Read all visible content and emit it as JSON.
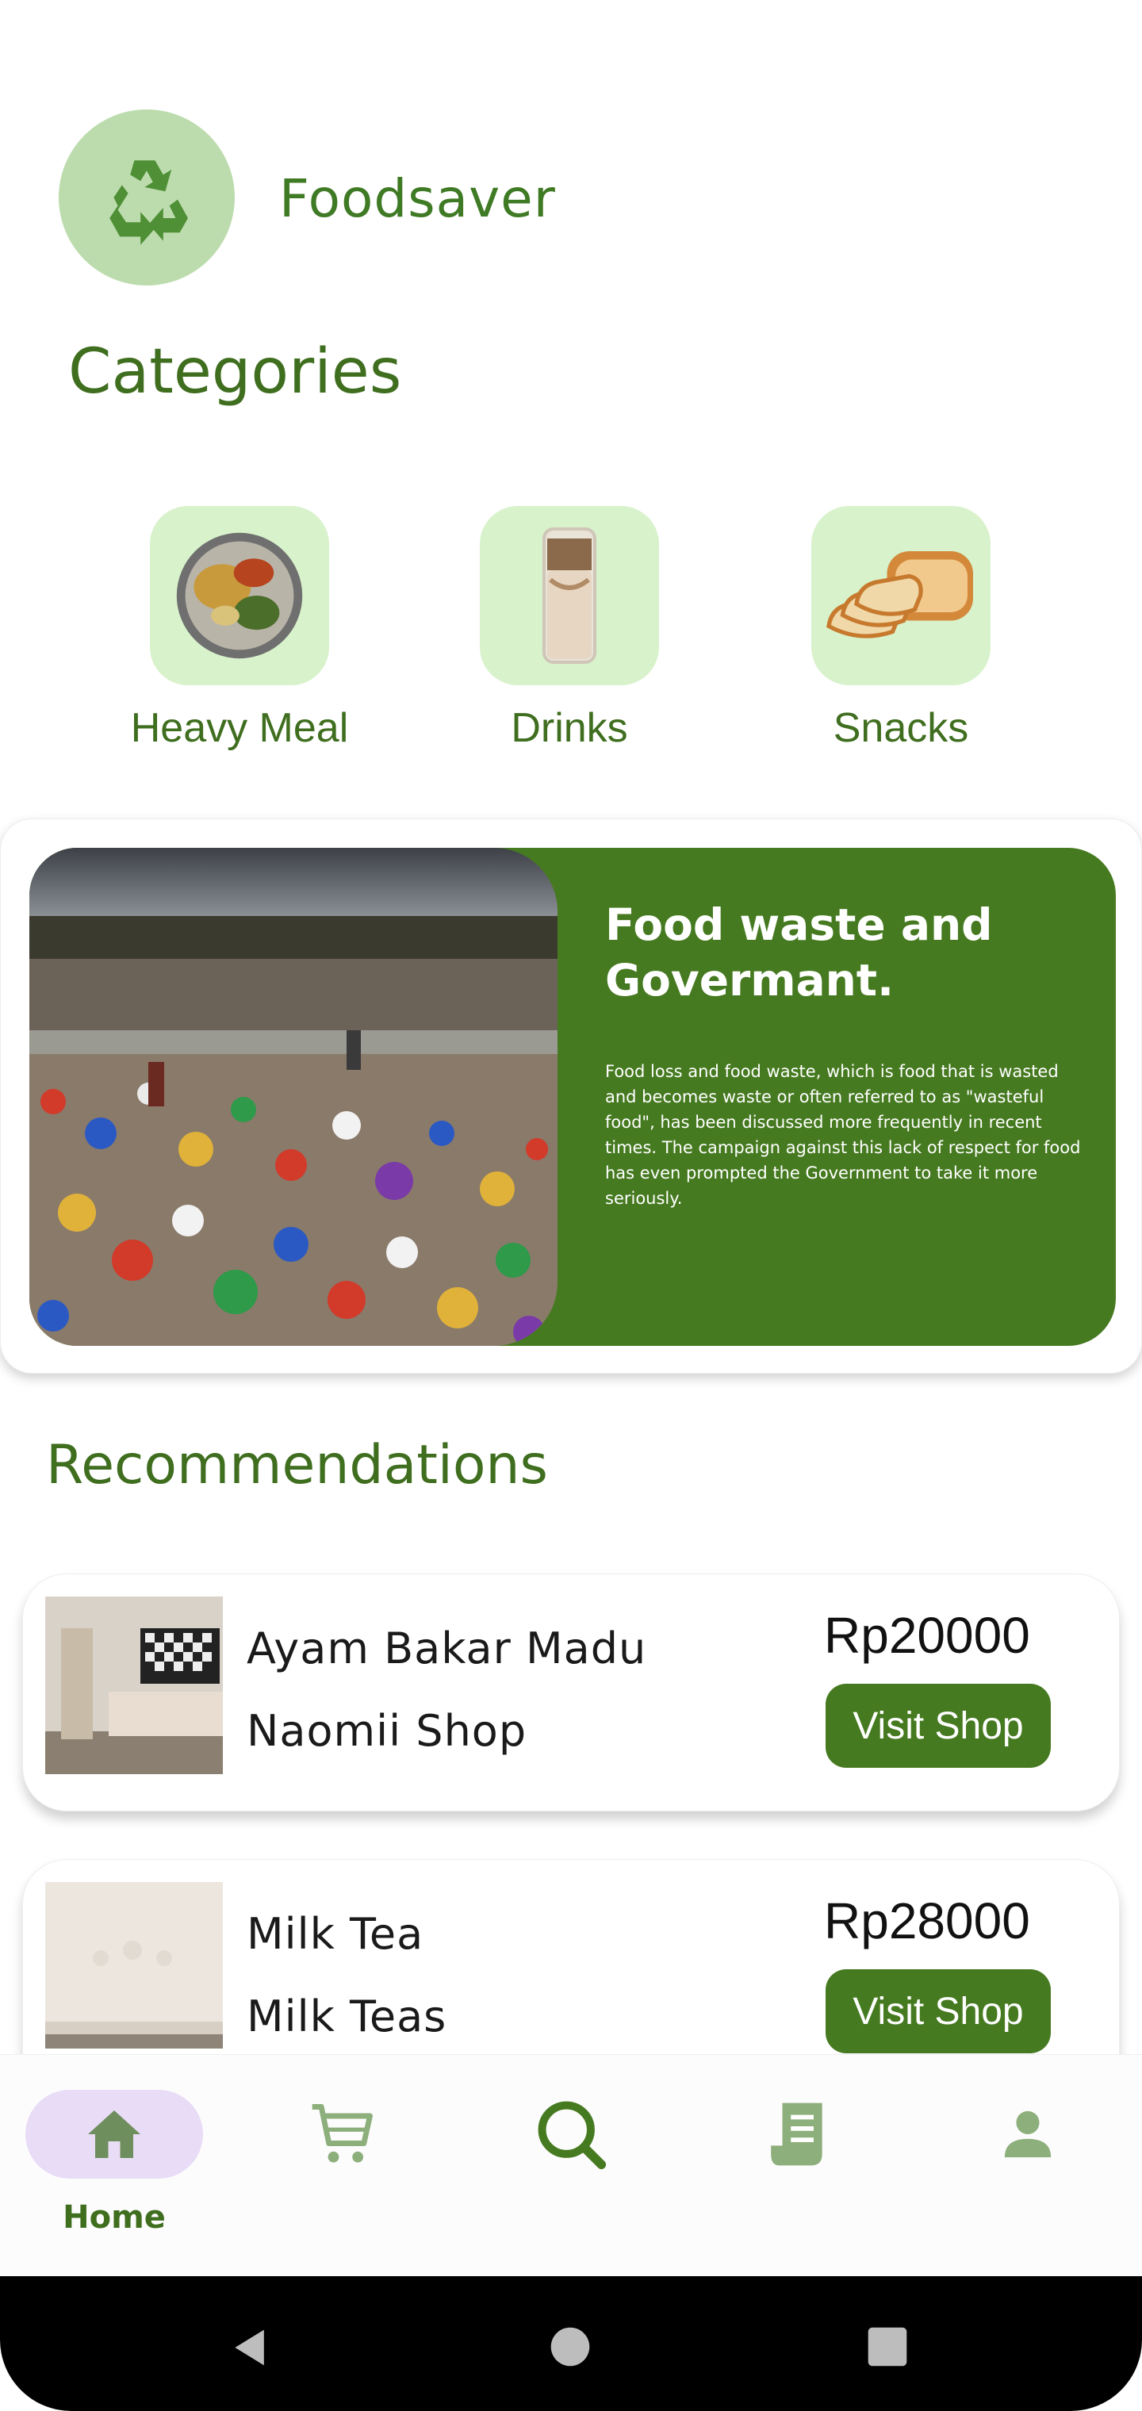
{
  "app": {
    "name": "Foodsaver",
    "logo_icon": "recycle-icon"
  },
  "categories": {
    "title": "Categories",
    "items": [
      {
        "label": "Heavy Meal",
        "icon": "heavy-meal-image"
      },
      {
        "label": "Drinks",
        "icon": "drink-image"
      },
      {
        "label": "Snacks",
        "icon": "bread-image"
      }
    ]
  },
  "banner": {
    "heading": "Food waste and Govermant.",
    "body": "Food loss and food waste, which is food that is wasted and becomes waste or often referred to as \"wasteful food\", has been discussed more frequently in recent times. The campaign against this lack of respect for food has even prompted the Government to take it more seriously."
  },
  "recommendations": {
    "title": "Recommendations",
    "items": [
      {
        "name": "Ayam Bakar Madu",
        "shop": "Naomii Shop",
        "price": "Rp20000",
        "button": "Visit Shop"
      },
      {
        "name": "Milk Tea",
        "shop": "Milk Teas",
        "price": "Rp28000",
        "button": "Visit Shop"
      }
    ]
  },
  "bottom_nav": {
    "items": [
      {
        "label": "Home",
        "icon": "home-icon",
        "active": true
      },
      {
        "label": "",
        "icon": "cart-icon",
        "active": false
      },
      {
        "label": "",
        "icon": "search-icon",
        "active": false
      },
      {
        "label": "",
        "icon": "receipt-icon",
        "active": false
      },
      {
        "label": "",
        "icon": "profile-icon",
        "active": false
      }
    ]
  },
  "colors": {
    "primary": "#467a20",
    "tile_bg": "#d8f2cb",
    "logo_bg": "#bcdcae",
    "active_pill": "#e8dcf6"
  }
}
